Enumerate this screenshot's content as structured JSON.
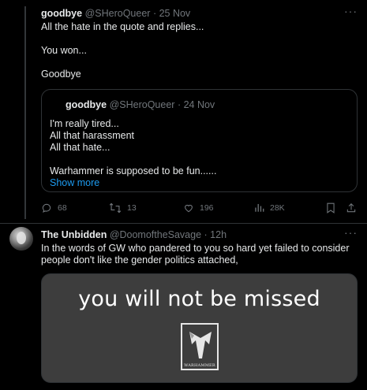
{
  "tweet1": {
    "name": "goodbye",
    "handle": "@SHeroQueer",
    "date": "· 25 Nov",
    "more_label": "···",
    "lines": [
      "All the hate in the quote and replies...",
      "You won...",
      "Goodbye"
    ]
  },
  "quote": {
    "name": "goodbye",
    "handle": "@SHeroQueer",
    "date": "· 24 Nov",
    "lines": [
      "I'm really tired...",
      "All that harassment",
      "All that hate...",
      "Warhammer is supposed to be fun......"
    ],
    "show_more": "Show more"
  },
  "actions": {
    "replies": "68",
    "retweets": "13",
    "likes": "196",
    "views": "28K",
    "icons": [
      "reply-icon",
      "retweet-icon",
      "like-icon",
      "views-icon",
      "bookmark-icon",
      "share-icon"
    ]
  },
  "tweet2": {
    "name": "The Unbidden",
    "handle": "@DoomoftheSavage",
    "date": "· 12h",
    "more_label": "···",
    "text_line1": "In the words of GW who pandered to you so hard yet failed to consider",
    "text_line2": "people don't like the gender politics attached,"
  },
  "media": {
    "caption": "you will not be missed",
    "logo_text": "WARHAMMER"
  },
  "colors": {
    "background": "#000000",
    "text": "#e7e9ea",
    "muted": "#71767b",
    "link": "#1d9bf0",
    "border": "#2f3336"
  }
}
